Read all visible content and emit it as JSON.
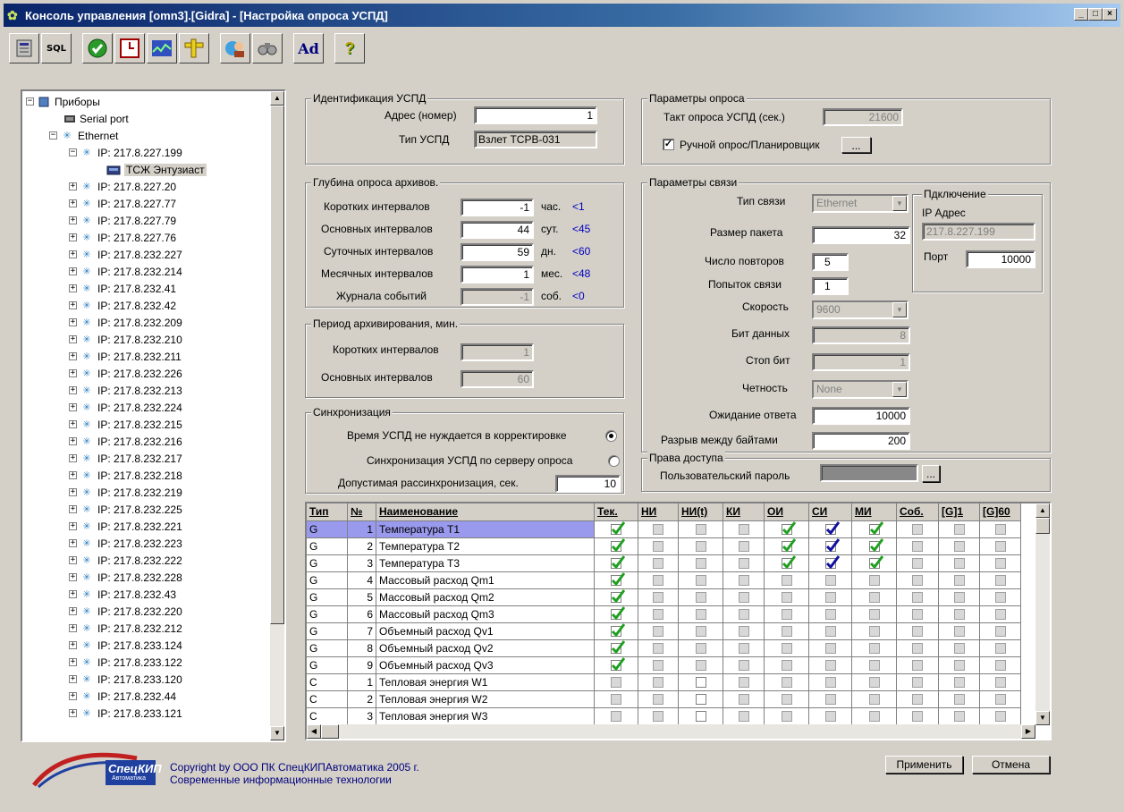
{
  "window": {
    "title": "Консоль управления [omn3].[Gidra] - [Настройка опроса УСПД]",
    "controls": [
      "_",
      "□",
      "×"
    ]
  },
  "toolbar": {
    "buttons": [
      {
        "name": "db-icon",
        "label": ""
      },
      {
        "name": "sql-icon",
        "label": "SQL"
      },
      {
        "name": "check-icon",
        "label": ""
      },
      {
        "name": "clock-icon",
        "label": ""
      },
      {
        "name": "chart-icon",
        "label": ""
      },
      {
        "name": "ruler-icon",
        "label": ""
      },
      {
        "name": "user-globe-icon",
        "label": ""
      },
      {
        "name": "binoculars-icon",
        "label": ""
      },
      {
        "name": "font-icon",
        "label": "Ad"
      },
      {
        "name": "help-icon",
        "label": "?"
      }
    ]
  },
  "tree": {
    "root": "Приборы",
    "serial": "Serial port",
    "ethernet": "Ethernet",
    "expanded_ip": "IP: 217.8.227.199",
    "device": "ТСЖ Энтузиаст",
    "ips": [
      "IP: 217.8.227.20",
      "IP: 217.8.227.77",
      "IP: 217.8.227.79",
      "IP: 217.8.227.76",
      "IP: 217.8.232.227",
      "IP: 217.8.232.214",
      "IP: 217.8.232.41",
      "IP: 217.8.232.42",
      "IP: 217.8.232.209",
      "IP: 217.8.232.210",
      "IP: 217.8.232.211",
      "IP: 217.8.232.226",
      "IP: 217.8.232.213",
      "IP: 217.8.232.224",
      "IP: 217.8.232.215",
      "IP: 217.8.232.216",
      "IP: 217.8.232.217",
      "IP: 217.8.232.218",
      "IP: 217.8.232.219",
      "IP: 217.8.232.225",
      "IP: 217.8.232.221",
      "IP: 217.8.232.223",
      "IP: 217.8.232.222",
      "IP: 217.8.232.228",
      "IP: 217.8.232.43",
      "IP: 217.8.232.220",
      "IP: 217.8.232.212",
      "IP: 217.8.233.124",
      "IP: 217.8.233.122",
      "IP: 217.8.233.120",
      "IP: 217.8.232.44",
      "IP: 217.8.233.121"
    ]
  },
  "ident": {
    "title": "Идентификация УСПД",
    "addr_label": "Адрес (номер)",
    "addr_value": "1",
    "type_label": "Тип УСПД",
    "type_value": "Взлет ТСРВ-031"
  },
  "depth": {
    "title": "Глубина опроса архивов.",
    "rows": [
      {
        "label": "Коротких интервалов",
        "value": "-1",
        "unit": "час.",
        "limit": "<1",
        "disabled": false
      },
      {
        "label": "Основных интервалов",
        "value": "44",
        "unit": "сут.",
        "limit": "<45",
        "disabled": false
      },
      {
        "label": "Суточных интервалов",
        "value": "59",
        "unit": "дн.",
        "limit": "<60",
        "disabled": false
      },
      {
        "label": "Месячных интервалов",
        "value": "1",
        "unit": "мес.",
        "limit": "<48",
        "disabled": false
      },
      {
        "label": "Журнала событий",
        "value": "-1",
        "unit": "соб.",
        "limit": "<0",
        "disabled": true
      }
    ]
  },
  "period": {
    "title": "Период архивирования, мин.",
    "short_label": "Коротких интервалов",
    "short_value": "1",
    "main_label": "Основных интервалов",
    "main_value": "60"
  },
  "sync": {
    "title": "Синхронизация",
    "opt1": "Время УСПД не нуждается в корректировке",
    "opt2": "Синхронизация УСПД по серверу опроса",
    "tol_label": "Допустимая рассинхронизация, сек.",
    "tol_value": "10"
  },
  "poll": {
    "title": "Параметры опроса",
    "tact_label": "Такт опроса УСПД (сек.)",
    "tact_value": "21600",
    "manual_label": "Ручной опрос/Планировщик",
    "more": "..."
  },
  "comm": {
    "title": "Параметры связи",
    "type_label": "Тип связи",
    "type_value": "Ethernet",
    "packet_label": "Размер пакета",
    "packet_value": "32",
    "retry_label": "Число повторов",
    "retry_value": "5",
    "attempts_label": "Попыток связи",
    "attempts_value": "1",
    "speed_label": "Скорость",
    "speed_value": "9600",
    "bits_label": "Бит данных",
    "bits_value": "8",
    "stop_label": "Стоп бит",
    "stop_value": "1",
    "parity_label": "Четность",
    "parity_value": "None",
    "wait_label": "Ожидание ответа",
    "wait_value": "10000",
    "gap_label": "Разрыв между байтами",
    "gap_value": "200",
    "conn_title": "Пдключение",
    "ip_label": "IP Адрес",
    "ip_value": "217.8.227.199",
    "port_label": "Порт",
    "port_value": "10000"
  },
  "access": {
    "title": "Права доступа",
    "pwd_label": "Пользовательский пароль",
    "more": "..."
  },
  "grid": {
    "headers": [
      "Тип",
      "№",
      "Наименование",
      "Тек.",
      "НИ",
      "НИ(t)",
      "КИ",
      "ОИ",
      "СИ",
      "МИ",
      "Соб.",
      "[G]1",
      "[G]60"
    ],
    "rows": [
      {
        "type": "G",
        "num": "1",
        "name": "Температура T1",
        "checks": [
          "g",
          "d",
          "d",
          "d",
          "g",
          "b",
          "g",
          "d",
          "d",
          "d"
        ]
      },
      {
        "type": "G",
        "num": "2",
        "name": "Температура T2",
        "checks": [
          "g",
          "d",
          "d",
          "d",
          "g",
          "b",
          "g",
          "d",
          "d",
          "d"
        ]
      },
      {
        "type": "G",
        "num": "3",
        "name": "Температура T3",
        "checks": [
          "g",
          "d",
          "d",
          "d",
          "g",
          "b",
          "g",
          "d",
          "d",
          "d"
        ]
      },
      {
        "type": "G",
        "num": "4",
        "name": "Массовый расход Qm1",
        "checks": [
          "g",
          "d",
          "d",
          "d",
          "d",
          "d",
          "d",
          "d",
          "d",
          "d"
        ]
      },
      {
        "type": "G",
        "num": "5",
        "name": "Массовый расход Qm2",
        "checks": [
          "g",
          "d",
          "d",
          "d",
          "d",
          "d",
          "d",
          "d",
          "d",
          "d"
        ]
      },
      {
        "type": "G",
        "num": "6",
        "name": "Массовый расход Qm3",
        "checks": [
          "g",
          "d",
          "d",
          "d",
          "d",
          "d",
          "d",
          "d",
          "d",
          "d"
        ]
      },
      {
        "type": "G",
        "num": "7",
        "name": "Объемный расход Qv1",
        "checks": [
          "g",
          "d",
          "d",
          "d",
          "d",
          "d",
          "d",
          "d",
          "d",
          "d"
        ]
      },
      {
        "type": "G",
        "num": "8",
        "name": "Объемный расход Qv2",
        "checks": [
          "g",
          "d",
          "d",
          "d",
          "d",
          "d",
          "d",
          "d",
          "d",
          "d"
        ]
      },
      {
        "type": "G",
        "num": "9",
        "name": "Объемный расход Qv3",
        "checks": [
          "g",
          "d",
          "d",
          "d",
          "d",
          "d",
          "d",
          "d",
          "d",
          "d"
        ]
      },
      {
        "type": "C",
        "num": "1",
        "name": "Тепловая энергия W1",
        "checks": [
          "d",
          "d",
          "w",
          "d",
          "d",
          "d",
          "d",
          "d",
          "d",
          "d"
        ]
      },
      {
        "type": "C",
        "num": "2",
        "name": "Тепловая энергия W2",
        "checks": [
          "d",
          "d",
          "w",
          "d",
          "d",
          "d",
          "d",
          "d",
          "d",
          "d"
        ]
      },
      {
        "type": "C",
        "num": "3",
        "name": "Тепловая энергия W3",
        "checks": [
          "d",
          "d",
          "w",
          "d",
          "d",
          "d",
          "d",
          "d",
          "d",
          "d"
        ]
      }
    ]
  },
  "buttons": {
    "apply": "Применить",
    "cancel": "Отмена"
  },
  "footer": {
    "logo_text": "СпецКИП",
    "logo_sub": "Автоматика",
    "line1": "Copyright by ООО ПК СпецКИПАвтоматика 2005 г.",
    "line2": "Современные информационные технологии"
  }
}
